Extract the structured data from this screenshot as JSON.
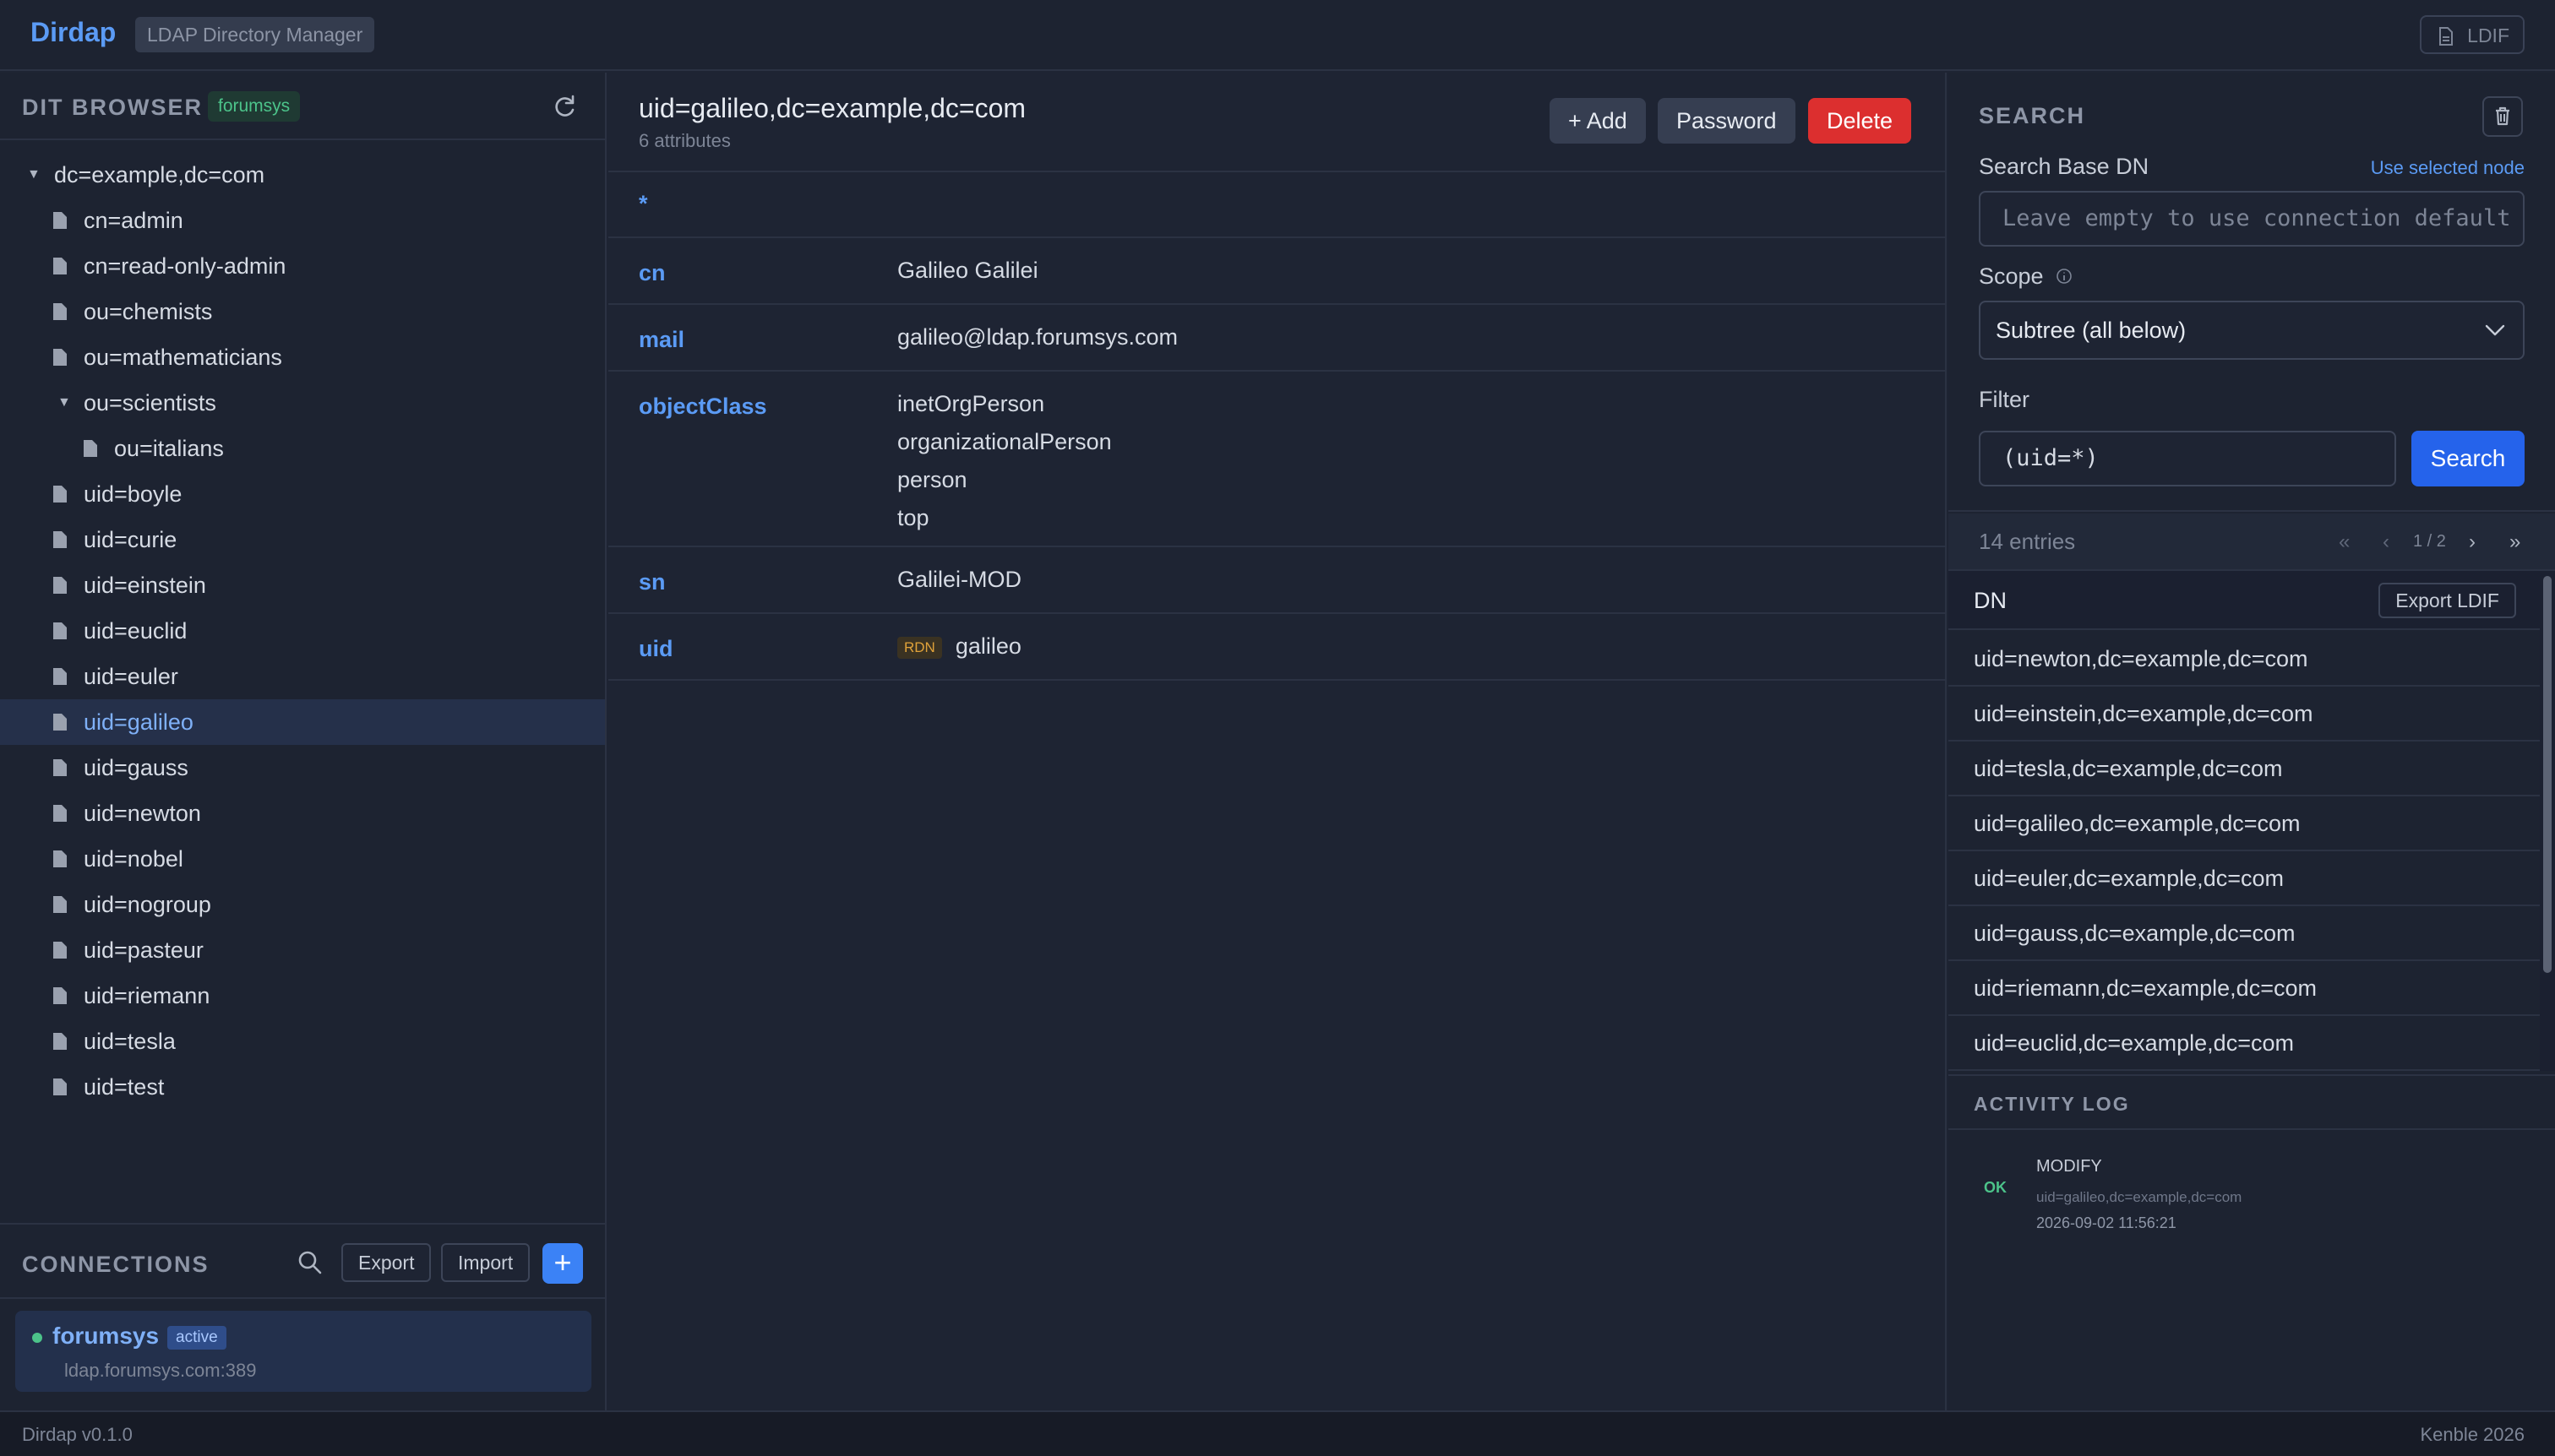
{
  "app": {
    "name": "Dirdap",
    "subtitle": "LDAP Directory Manager",
    "ldif_button": "LDIF"
  },
  "dit": {
    "title": "DIT BROWSER",
    "badge": "forumsys",
    "tree": [
      {
        "label": "dc=example,dc=com",
        "depth": 0,
        "expanded": true
      },
      {
        "label": "cn=admin",
        "depth": 1
      },
      {
        "label": "cn=read-only-admin",
        "depth": 1
      },
      {
        "label": "ou=chemists",
        "depth": 1
      },
      {
        "label": "ou=mathematicians",
        "depth": 1
      },
      {
        "label": "ou=scientists",
        "depth": 1,
        "expanded": true
      },
      {
        "label": "ou=italians",
        "depth": 2
      },
      {
        "label": "uid=boyle",
        "depth": 1
      },
      {
        "label": "uid=curie",
        "depth": 1
      },
      {
        "label": "uid=einstein",
        "depth": 1
      },
      {
        "label": "uid=euclid",
        "depth": 1
      },
      {
        "label": "uid=euler",
        "depth": 1
      },
      {
        "label": "uid=galileo",
        "depth": 1,
        "selected": true
      },
      {
        "label": "uid=gauss",
        "depth": 1
      },
      {
        "label": "uid=newton",
        "depth": 1
      },
      {
        "label": "uid=nobel",
        "depth": 1
      },
      {
        "label": "uid=nogroup",
        "depth": 1
      },
      {
        "label": "uid=pasteur",
        "depth": 1
      },
      {
        "label": "uid=riemann",
        "depth": 1
      },
      {
        "label": "uid=tesla",
        "depth": 1
      },
      {
        "label": "uid=test",
        "depth": 1
      }
    ]
  },
  "connections": {
    "title": "CONNECTIONS",
    "export_label": "Export",
    "import_label": "Import",
    "add_label": "+",
    "items": [
      {
        "name": "forumsys",
        "status": "active",
        "host": "ldap.forumsys.com:389"
      }
    ]
  },
  "entry": {
    "dn": "uid=galileo,dc=example,dc=com",
    "attr_count": "6 attributes",
    "buttons": {
      "add": "+ Add",
      "password": "Password",
      "delete": "Delete"
    },
    "filter_marker": "*",
    "attributes": [
      {
        "name": "cn",
        "values": [
          "Galileo Galilei"
        ]
      },
      {
        "name": "mail",
        "values": [
          "galileo@ldap.forumsys.com"
        ]
      },
      {
        "name": "objectClass",
        "values": [
          "inetOrgPerson",
          "organizationalPerson",
          "person",
          "top"
        ]
      },
      {
        "name": "sn",
        "values": [
          "Galilei-MOD"
        ]
      },
      {
        "name": "uid",
        "values": [
          "galileo"
        ],
        "rdn_badge": "RDN"
      }
    ]
  },
  "search": {
    "title": "SEARCH",
    "base_dn_label": "Search Base DN",
    "use_selected": "Use selected node",
    "base_dn_placeholder": "Leave empty to use connection default",
    "scope_label": "Scope",
    "scope_value": "Subtree (all below)",
    "filter_label": "Filter",
    "filter_value": "(uid=*)",
    "search_button": "Search",
    "entries_count": "14 entries",
    "page": "1 / 2",
    "pager": {
      "first": "«",
      "prev": "‹",
      "next": "›",
      "last": "»"
    },
    "column_dn": "DN",
    "export_ldif": "Export LDIF",
    "results": [
      "uid=newton,dc=example,dc=com",
      "uid=einstein,dc=example,dc=com",
      "uid=tesla,dc=example,dc=com",
      "uid=galileo,dc=example,dc=com",
      "uid=euler,dc=example,dc=com",
      "uid=gauss,dc=example,dc=com",
      "uid=riemann,dc=example,dc=com",
      "uid=euclid,dc=example,dc=com"
    ]
  },
  "activity": {
    "title": "ACTIVITY LOG",
    "entries": [
      {
        "status": "OK",
        "operation": "MODIFY",
        "dn": "uid=galileo,dc=example,dc=com",
        "timestamp": "2026-09-02 11:56:21"
      }
    ]
  },
  "footer": {
    "version": "Dirdap v0.1.0",
    "credit": "Kenble 2026"
  }
}
